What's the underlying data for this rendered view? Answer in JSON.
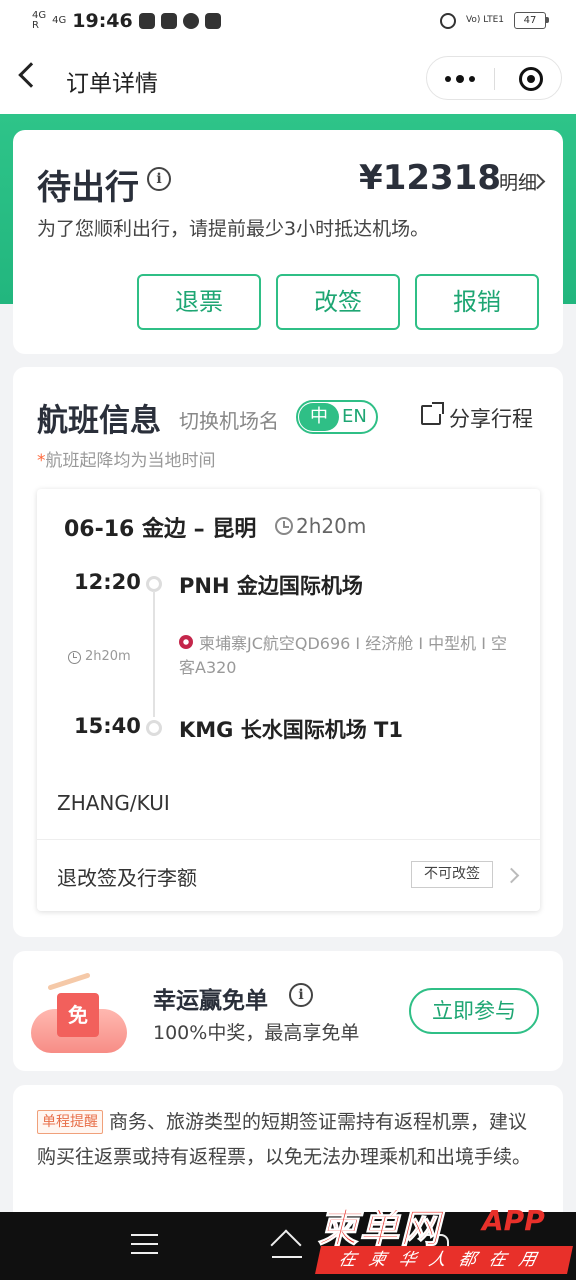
{
  "status_bar": {
    "signal_left": "4G",
    "signal_left_roaming": "R",
    "signal_right": "4G",
    "time": "19:46",
    "volte": "Vo) LTE1",
    "battery": "47"
  },
  "nav": {
    "title": "订单详情"
  },
  "order": {
    "status": "待出行",
    "price": "¥12318",
    "detail_label": "明细",
    "note": "为了您顺利出行，请提前最少3小时抵达机场。",
    "buttons": {
      "refund": "退票",
      "change": "改签",
      "reimburse": "报销"
    }
  },
  "flight": {
    "section_title": "航班信息",
    "switch_label": "切换机场名",
    "toggle_zh": "中",
    "toggle_en": "EN",
    "share": "分享行程",
    "tz_star": "*",
    "tz_note": "航班起降均为当地时间",
    "route": "06-16 金边 – 昆明",
    "route_duration": "2h20m",
    "depart_time": "12:20",
    "depart_airport": "PNH 金边国际机场",
    "duration": "2h20m",
    "airline_info": "柬埔寨JC航空QD696 I 经济舱 I 中型机 I 空客A320",
    "arrive_time": "15:40",
    "arrive_airport": "KMG 长水国际机场 T1",
    "passenger": "ZHANG/KUI",
    "policy_label": "退改签及行李额",
    "policy_badge": "不可改签"
  },
  "promo": {
    "art_char": "免",
    "title": "幸运赢免单",
    "subtitle": "100%中奖，最高享免单",
    "button": "立即参与"
  },
  "reminder": {
    "tag": "单程提醒",
    "text": "商务、旅游类型的短期签证需持有返程机票，建议购买往返票或持有返程票，以免无法办理乘机和出境手续。"
  },
  "watermark": {
    "brand": "柬单网",
    "app": "APP",
    "slogan": "在柬华人都在用"
  }
}
